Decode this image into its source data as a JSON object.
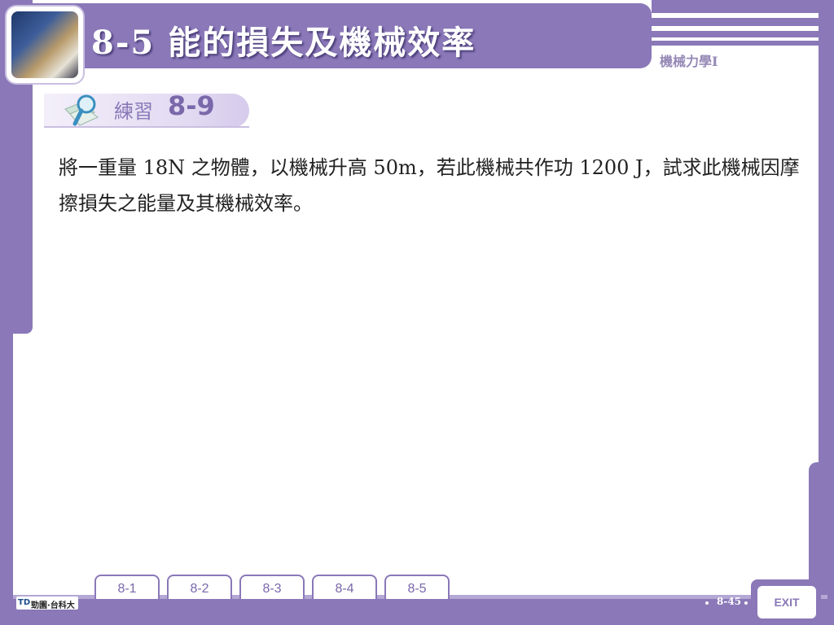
{
  "header": {
    "title": "8-5  能的損失及機械效率",
    "subject": "機械力學I"
  },
  "exercise": {
    "label": "練習",
    "number": "8-9"
  },
  "problem": {
    "text": "將一重量 18N 之物體，以機械升高 50m，若此機械共作功 1200 J，試求此機械因摩擦損失之能量及其機械效率。"
  },
  "nav": {
    "tabs": [
      {
        "label": "8-1"
      },
      {
        "label": "8-2"
      },
      {
        "label": "8-3"
      },
      {
        "label": "8-4"
      },
      {
        "label": "8-5"
      }
    ]
  },
  "footer": {
    "logo_mark": "TD",
    "logo_text": "勁園·台科大",
    "page_number": "8-45",
    "exit_label": "EXIT"
  },
  "colors": {
    "frame": "#8a78b8",
    "title_text": "#ffffff",
    "body_text": "#222222"
  }
}
